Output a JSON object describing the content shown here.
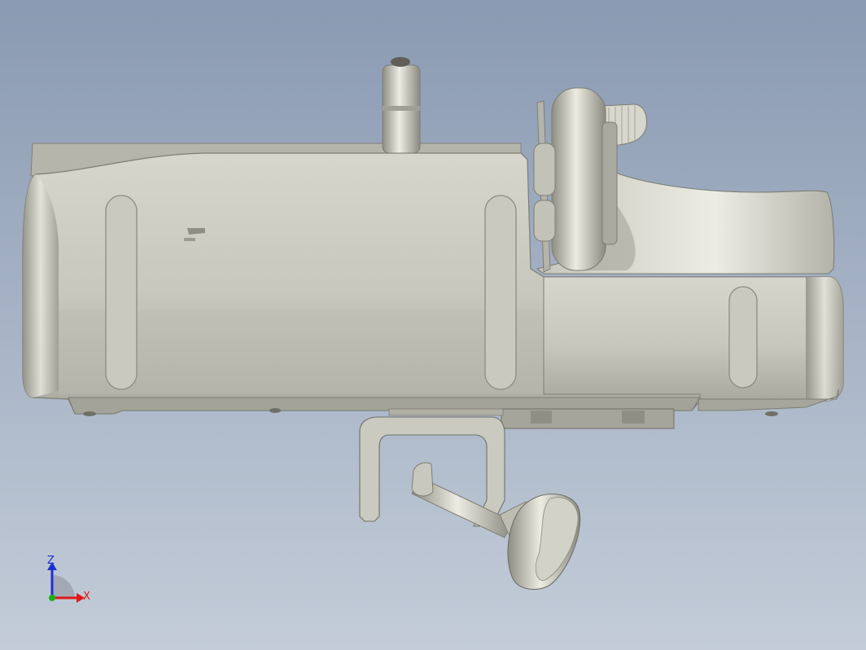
{
  "viewport": {
    "background_top": "#8a9ab2",
    "background_bottom": "#c3ccd8",
    "model_color": "#c6c6bc"
  },
  "triad": {
    "z_label": "Z",
    "x_label": "X",
    "z_color": "#1f2fd0",
    "x_color": "#e01818",
    "y_color": "#18b018"
  }
}
